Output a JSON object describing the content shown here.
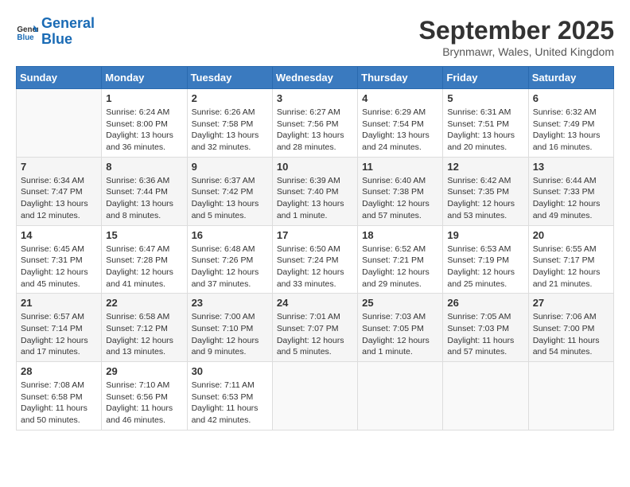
{
  "logo": {
    "line1": "General",
    "line2": "Blue"
  },
  "title": "September 2025",
  "location": "Brynmawr, Wales, United Kingdom",
  "weekdays": [
    "Sunday",
    "Monday",
    "Tuesday",
    "Wednesday",
    "Thursday",
    "Friday",
    "Saturday"
  ],
  "weeks": [
    [
      {
        "day": "",
        "info": ""
      },
      {
        "day": "1",
        "info": "Sunrise: 6:24 AM\nSunset: 8:00 PM\nDaylight: 13 hours\nand 36 minutes."
      },
      {
        "day": "2",
        "info": "Sunrise: 6:26 AM\nSunset: 7:58 PM\nDaylight: 13 hours\nand 32 minutes."
      },
      {
        "day": "3",
        "info": "Sunrise: 6:27 AM\nSunset: 7:56 PM\nDaylight: 13 hours\nand 28 minutes."
      },
      {
        "day": "4",
        "info": "Sunrise: 6:29 AM\nSunset: 7:54 PM\nDaylight: 13 hours\nand 24 minutes."
      },
      {
        "day": "5",
        "info": "Sunrise: 6:31 AM\nSunset: 7:51 PM\nDaylight: 13 hours\nand 20 minutes."
      },
      {
        "day": "6",
        "info": "Sunrise: 6:32 AM\nSunset: 7:49 PM\nDaylight: 13 hours\nand 16 minutes."
      }
    ],
    [
      {
        "day": "7",
        "info": "Sunrise: 6:34 AM\nSunset: 7:47 PM\nDaylight: 13 hours\nand 12 minutes."
      },
      {
        "day": "8",
        "info": "Sunrise: 6:36 AM\nSunset: 7:44 PM\nDaylight: 13 hours\nand 8 minutes."
      },
      {
        "day": "9",
        "info": "Sunrise: 6:37 AM\nSunset: 7:42 PM\nDaylight: 13 hours\nand 5 minutes."
      },
      {
        "day": "10",
        "info": "Sunrise: 6:39 AM\nSunset: 7:40 PM\nDaylight: 13 hours\nand 1 minute."
      },
      {
        "day": "11",
        "info": "Sunrise: 6:40 AM\nSunset: 7:38 PM\nDaylight: 12 hours\nand 57 minutes."
      },
      {
        "day": "12",
        "info": "Sunrise: 6:42 AM\nSunset: 7:35 PM\nDaylight: 12 hours\nand 53 minutes."
      },
      {
        "day": "13",
        "info": "Sunrise: 6:44 AM\nSunset: 7:33 PM\nDaylight: 12 hours\nand 49 minutes."
      }
    ],
    [
      {
        "day": "14",
        "info": "Sunrise: 6:45 AM\nSunset: 7:31 PM\nDaylight: 12 hours\nand 45 minutes."
      },
      {
        "day": "15",
        "info": "Sunrise: 6:47 AM\nSunset: 7:28 PM\nDaylight: 12 hours\nand 41 minutes."
      },
      {
        "day": "16",
        "info": "Sunrise: 6:48 AM\nSunset: 7:26 PM\nDaylight: 12 hours\nand 37 minutes."
      },
      {
        "day": "17",
        "info": "Sunrise: 6:50 AM\nSunset: 7:24 PM\nDaylight: 12 hours\nand 33 minutes."
      },
      {
        "day": "18",
        "info": "Sunrise: 6:52 AM\nSunset: 7:21 PM\nDaylight: 12 hours\nand 29 minutes."
      },
      {
        "day": "19",
        "info": "Sunrise: 6:53 AM\nSunset: 7:19 PM\nDaylight: 12 hours\nand 25 minutes."
      },
      {
        "day": "20",
        "info": "Sunrise: 6:55 AM\nSunset: 7:17 PM\nDaylight: 12 hours\nand 21 minutes."
      }
    ],
    [
      {
        "day": "21",
        "info": "Sunrise: 6:57 AM\nSunset: 7:14 PM\nDaylight: 12 hours\nand 17 minutes."
      },
      {
        "day": "22",
        "info": "Sunrise: 6:58 AM\nSunset: 7:12 PM\nDaylight: 12 hours\nand 13 minutes."
      },
      {
        "day": "23",
        "info": "Sunrise: 7:00 AM\nSunset: 7:10 PM\nDaylight: 12 hours\nand 9 minutes."
      },
      {
        "day": "24",
        "info": "Sunrise: 7:01 AM\nSunset: 7:07 PM\nDaylight: 12 hours\nand 5 minutes."
      },
      {
        "day": "25",
        "info": "Sunrise: 7:03 AM\nSunset: 7:05 PM\nDaylight: 12 hours\nand 1 minute."
      },
      {
        "day": "26",
        "info": "Sunrise: 7:05 AM\nSunset: 7:03 PM\nDaylight: 11 hours\nand 57 minutes."
      },
      {
        "day": "27",
        "info": "Sunrise: 7:06 AM\nSunset: 7:00 PM\nDaylight: 11 hours\nand 54 minutes."
      }
    ],
    [
      {
        "day": "28",
        "info": "Sunrise: 7:08 AM\nSunset: 6:58 PM\nDaylight: 11 hours\nand 50 minutes."
      },
      {
        "day": "29",
        "info": "Sunrise: 7:10 AM\nSunset: 6:56 PM\nDaylight: 11 hours\nand 46 minutes."
      },
      {
        "day": "30",
        "info": "Sunrise: 7:11 AM\nSunset: 6:53 PM\nDaylight: 11 hours\nand 42 minutes."
      },
      {
        "day": "",
        "info": ""
      },
      {
        "day": "",
        "info": ""
      },
      {
        "day": "",
        "info": ""
      },
      {
        "day": "",
        "info": ""
      }
    ]
  ]
}
